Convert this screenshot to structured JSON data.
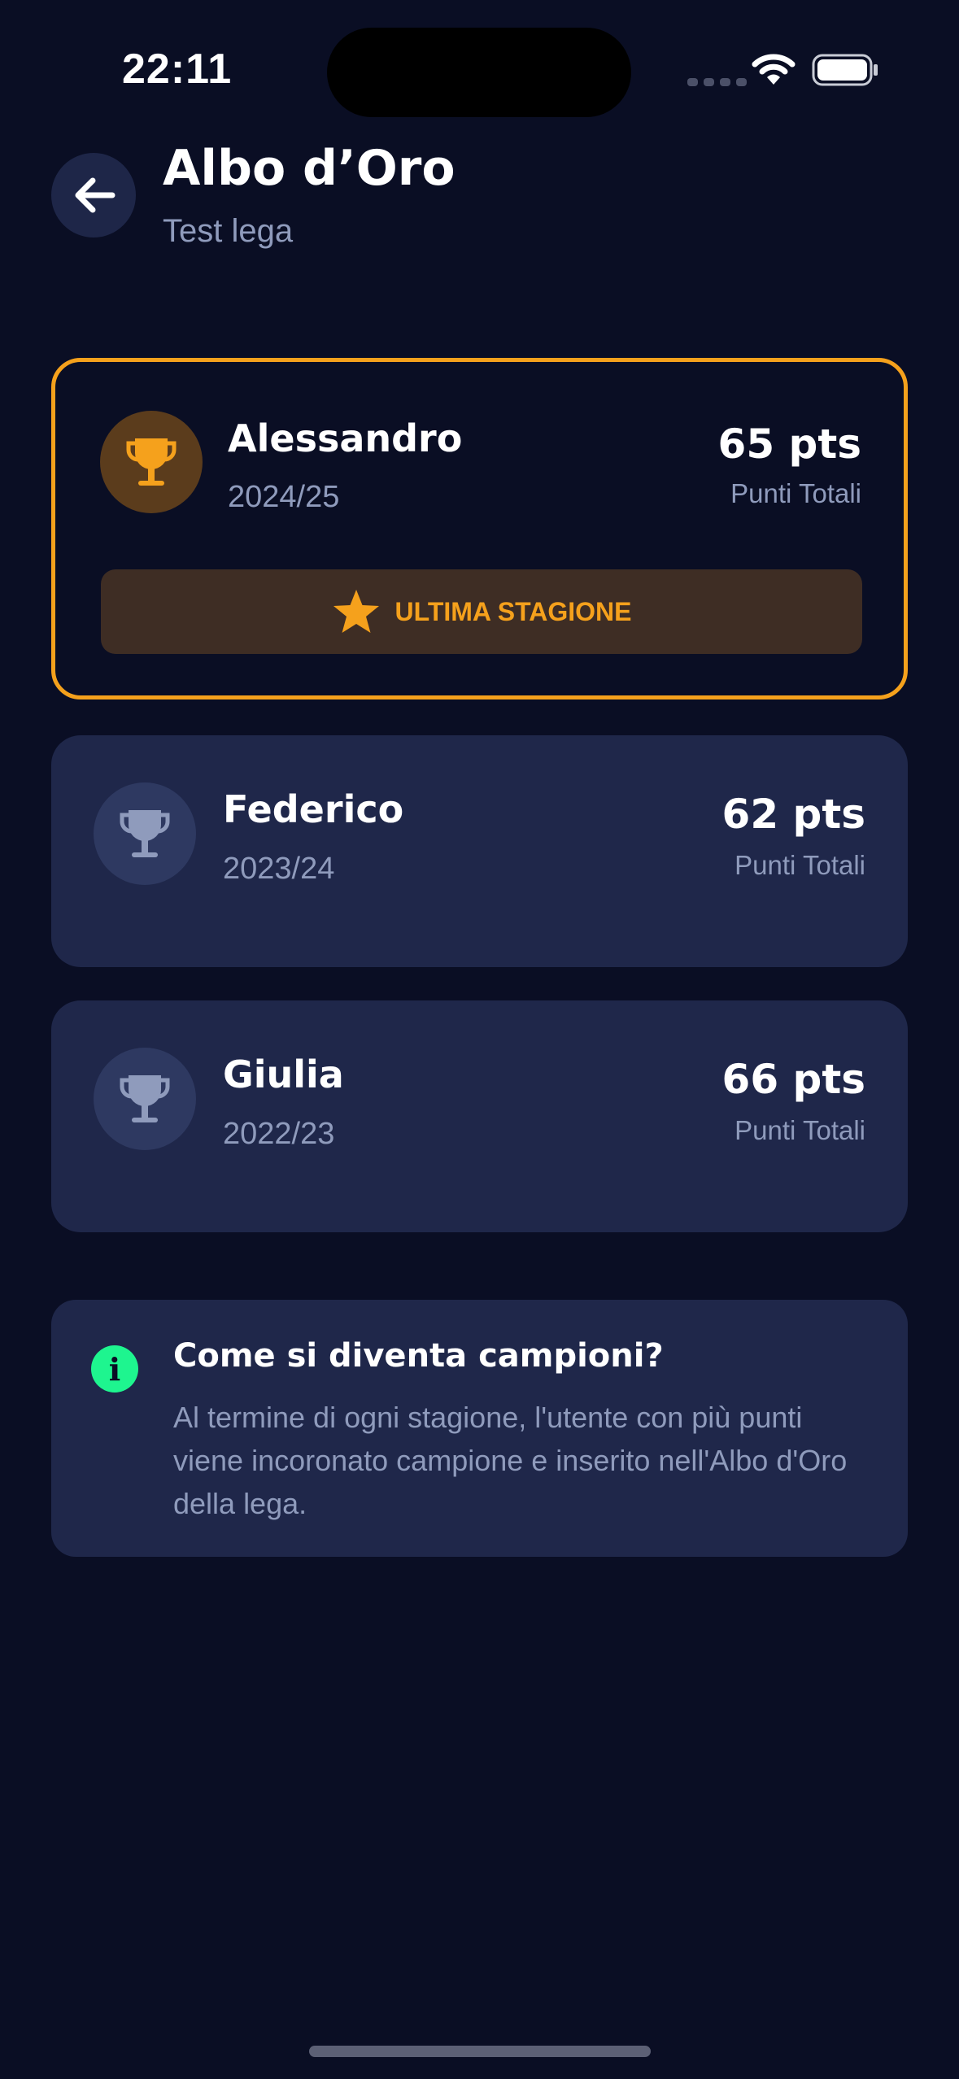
{
  "status_bar": {
    "time": "22:11"
  },
  "header": {
    "title": "Albo d’Oro",
    "subtitle": "Test lega",
    "back_icon": "arrow-left-icon"
  },
  "champions": [
    {
      "name": "Alessandro",
      "season": "2024/25",
      "points": "65 pts",
      "points_label": "Punti Totali",
      "badge": "ULTIMA STAGIONE",
      "trophy_color": "#f5a11c",
      "highlighted": true
    },
    {
      "name": "Federico",
      "season": "2023/24",
      "points": "62 pts",
      "points_label": "Punti Totali",
      "trophy_color": "#8f9bbc",
      "highlighted": false
    },
    {
      "name": "Giulia",
      "season": "2022/23",
      "points": "66 pts",
      "points_label": "Punti Totali",
      "trophy_color": "#8f9bbc",
      "highlighted": false
    }
  ],
  "info": {
    "icon": "info-icon",
    "icon_glyph": "i",
    "title": "Come si diventa campioni?",
    "text": "Al termine di ogni stagione, l'utente con più punti viene incoronato campione e inserito nell'Albo d'Oro della lega."
  },
  "colors": {
    "background": "#0a0e24",
    "card": "#1f274a",
    "accent_gold": "#f5a11c",
    "accent_green": "#1ef58f",
    "muted_text": "#8f9bbc"
  }
}
